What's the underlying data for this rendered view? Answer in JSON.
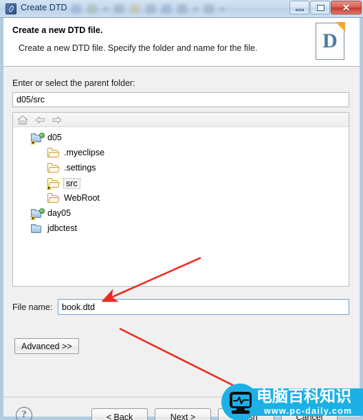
{
  "window": {
    "title": "Create DTD",
    "app_icon": "dtd-app-icon",
    "minimize_label": "",
    "maximize_label": "",
    "close_label": "✕"
  },
  "header": {
    "title": "Create a new DTD file.",
    "description": "Create a new DTD file. Specify the folder and name for the file.",
    "icon_letter": "D",
    "icon_name": "dtd-document-icon"
  },
  "form": {
    "parent_folder_label": "Enter or select the parent folder:",
    "parent_folder_value": "d05/src",
    "parent_folder_placeholder": "",
    "file_name_label": "File name:",
    "file_name_value": "book.dtd",
    "file_name_placeholder": "",
    "advanced_label": "Advanced >>"
  },
  "tree": {
    "toolbar": [
      {
        "name": "home-icon",
        "title": "Home"
      },
      {
        "name": "back-arrow-icon",
        "title": "Back"
      },
      {
        "name": "forward-arrow-icon",
        "title": "Forward"
      }
    ],
    "items": [
      {
        "label": "d05",
        "icon": "project-folder-icon",
        "indent": 0,
        "selected": false
      },
      {
        "label": ".myeclipse",
        "icon": "folder-icon",
        "indent": 1,
        "selected": false
      },
      {
        "label": ".settings",
        "icon": "folder-icon",
        "indent": 1,
        "selected": false
      },
      {
        "label": "src",
        "icon": "folder-warning-icon",
        "indent": 1,
        "selected": true
      },
      {
        "label": "WebRoot",
        "icon": "folder-icon",
        "indent": 1,
        "selected": false
      },
      {
        "label": "day05",
        "icon": "project-folder-icon",
        "indent": 0,
        "selected": false
      },
      {
        "label": "jdbctest",
        "icon": "project-folder-icon",
        "indent": 0,
        "selected": false
      }
    ]
  },
  "footer": {
    "help_label": "?",
    "back_label": "< Back",
    "next_label": "Next >",
    "finish_label": "Finish",
    "cancel_label": "Cancel"
  },
  "watermark": {
    "brand_cn": "电脑百科知识",
    "url": "www.pc-daily.com",
    "color": "#1cb0e6"
  },
  "annotations": {
    "arrow_color": "#ee2b22",
    "arrow_one_target": "file-name-input",
    "arrow_two_target": "finish-button"
  }
}
